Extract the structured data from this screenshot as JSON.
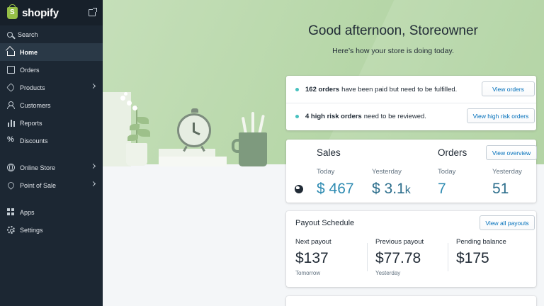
{
  "sidebar": {
    "brand": "shopify",
    "items": [
      {
        "label": "Search",
        "icon": "search-icon"
      },
      {
        "label": "Home",
        "icon": "home-icon"
      },
      {
        "label": "Orders",
        "icon": "orders-icon"
      },
      {
        "label": "Products",
        "icon": "tag-icon"
      },
      {
        "label": "Customers",
        "icon": "customers-icon"
      },
      {
        "label": "Reports",
        "icon": "bar-chart-icon"
      },
      {
        "label": "Discounts",
        "icon": "discount-icon"
      },
      {
        "label": "Online Store",
        "icon": "globe-icon"
      },
      {
        "label": "Point of Sale",
        "icon": "location-pin-icon"
      },
      {
        "label": "Apps",
        "icon": "apps-grid-icon"
      },
      {
        "label": "Settings",
        "icon": "gear-icon"
      }
    ]
  },
  "hero": {
    "greeting": "Good afternoon, Storeowner",
    "subtitle": "Here’s how your store is doing today."
  },
  "todo": {
    "row1_bold": "162 orders",
    "row1_text": "have been paid but need to be fulfilled.",
    "row1_button": "View orders",
    "row2_bold": "4 high risk orders",
    "row2_text": "need to be reviewed.",
    "row2_button": "View high risk orders"
  },
  "stats": {
    "sales_title": "Sales",
    "orders_title": "Orders",
    "overview_button": "View overview",
    "sales_today_label": "Today",
    "sales_today_value": "$ 467",
    "sales_yesterday_label": "Yesterday",
    "sales_yesterday_value": "$ 3.1",
    "sales_yesterday_suffix": "k",
    "orders_today_label": "Today",
    "orders_today_value": "7",
    "orders_yesterday_label": "Yesterday",
    "orders_yesterday_value": "51"
  },
  "payout": {
    "title": "Payout Schedule",
    "button": "View all payouts",
    "next_label": "Next payout",
    "next_amount": "$137",
    "next_sub": "Tomorrow",
    "prev_label": "Previous payout",
    "prev_amount": "$77.78",
    "prev_sub": "Yesterday",
    "pending_label": "Pending balance",
    "pending_amount": "$175"
  },
  "colors": {
    "sidebar_bg": "#1c2733",
    "brand_green": "#95bf47",
    "link_blue": "#006fbb",
    "stat_blue": "#2e8bb2",
    "hero_green": "#b9d8ab"
  }
}
